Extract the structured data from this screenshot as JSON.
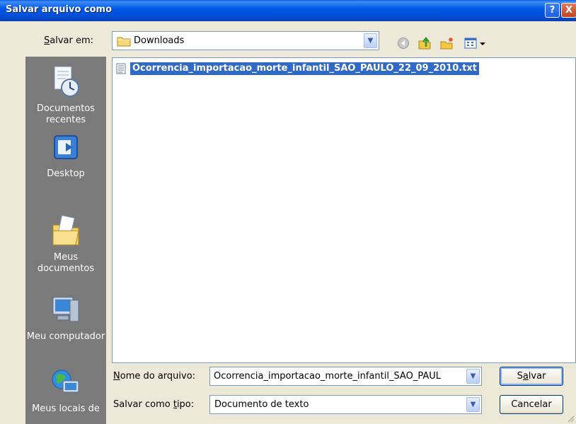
{
  "window": {
    "title": "Salvar arquivo como",
    "help_glyph": "?",
    "close_glyph": "X"
  },
  "save_in": {
    "label_prefix": "",
    "label_accel": "S",
    "label_rest": "alvar em:",
    "value": "Downloads"
  },
  "toolbar": {
    "icons": [
      "back-icon",
      "up-folder-icon",
      "new-folder-icon",
      "view-menu-icon"
    ]
  },
  "places": [
    {
      "label": "Documentos recentes",
      "icon": "recent-documents-icon"
    },
    {
      "label": "Desktop",
      "icon": "desktop-icon"
    },
    {
      "label": "Meus documentos",
      "icon": "my-documents-icon"
    },
    {
      "label": "Meu computador",
      "icon": "my-computer-icon"
    },
    {
      "label": "Meus locais de",
      "icon": "network-places-icon"
    }
  ],
  "files": [
    {
      "name": "Ocorrencia_importacao_morte_infantil_SAO_PAULO_22_09_2010.txt",
      "selected": true
    }
  ],
  "file_name": {
    "label_accel": "N",
    "label_rest": "ome do arquivo:",
    "value": "Ocorrencia_importacao_morte_infantil_SAO_PAUL"
  },
  "file_type": {
    "label_prefix": "Salvar como ",
    "label_accel": "t",
    "label_rest": "ipo:",
    "value": "Documento de texto"
  },
  "buttons": {
    "save_accel": "a",
    "save_prefix": "S",
    "save_rest": "lvar",
    "cancel": "Cancelar"
  },
  "colors": {
    "titlebar": "#0058e6",
    "selection": "#316ac5",
    "places_bg": "#7a7a7a",
    "dialog_bg": "#ece9d8"
  }
}
